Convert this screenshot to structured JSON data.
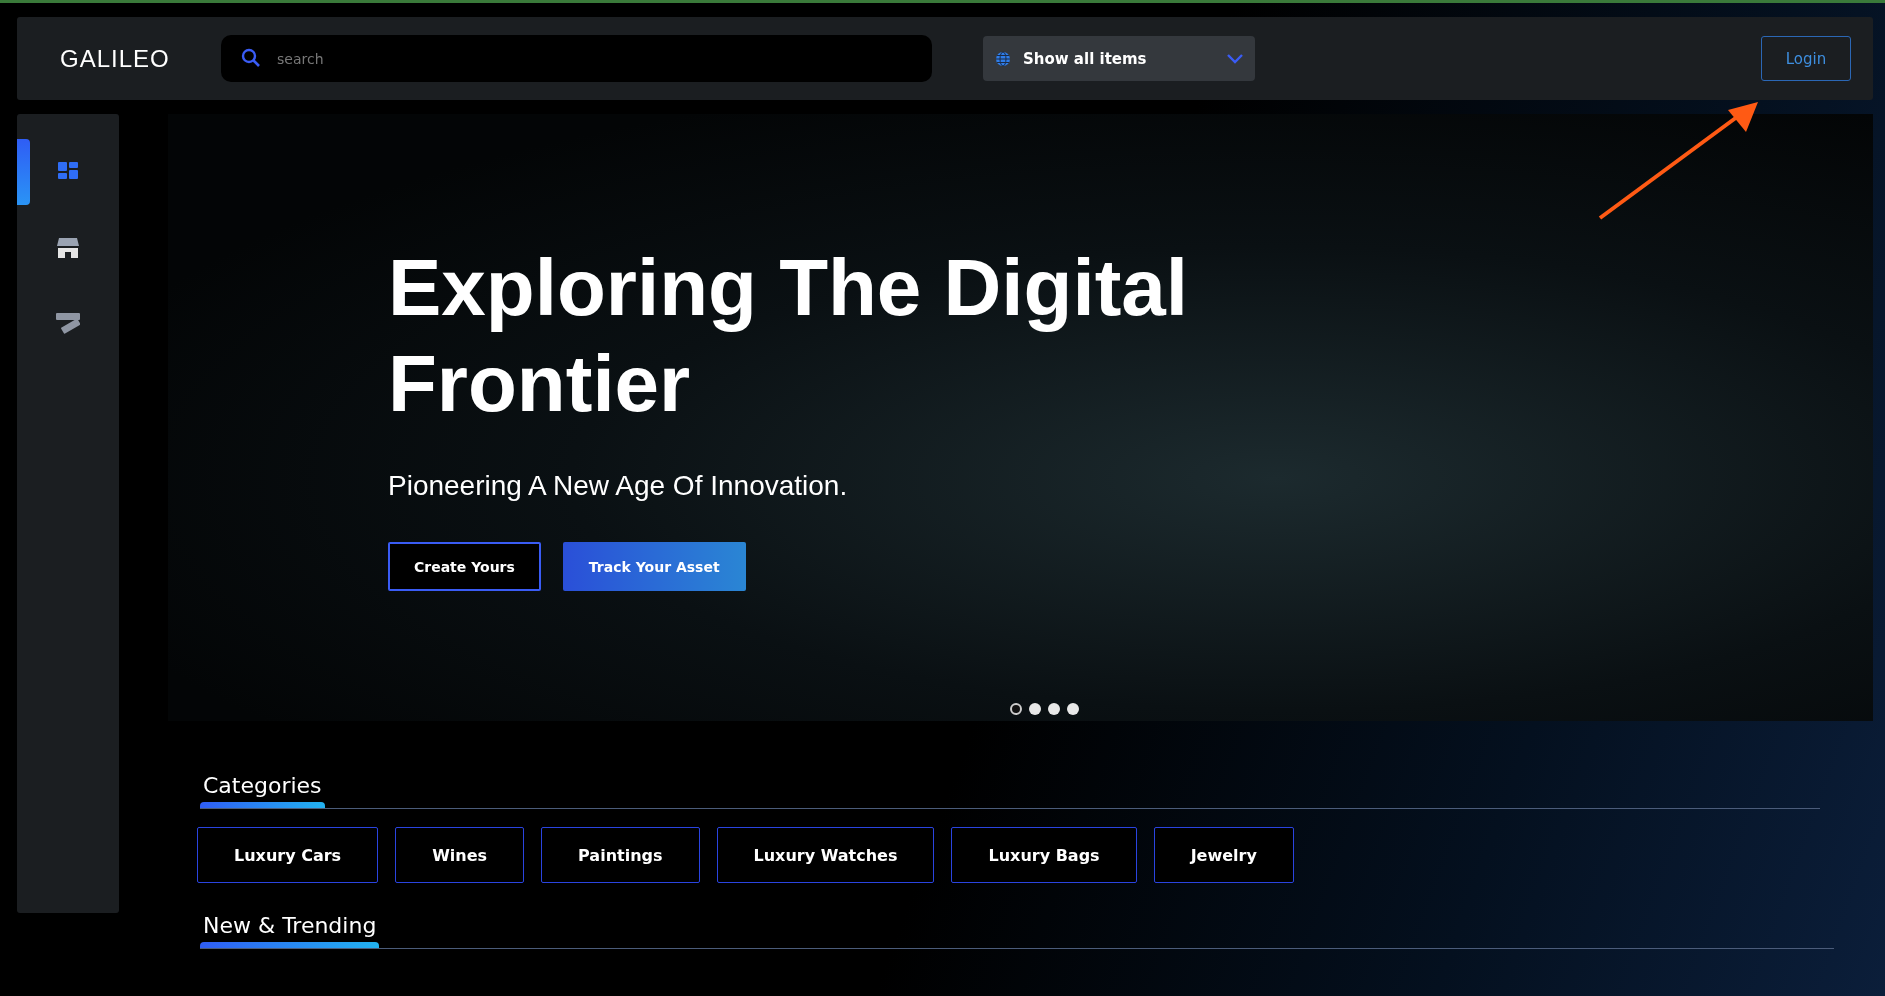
{
  "header": {
    "logo": "GALILEO",
    "search": {
      "placeholder": "search"
    },
    "filter": {
      "value": "Show all items"
    },
    "login": "Login"
  },
  "sidebar": {
    "items": [
      {
        "kind": "grid",
        "selected": true
      },
      {
        "kind": "store",
        "selected": false
      },
      {
        "kind": "coming-soon",
        "selected": false
      }
    ]
  },
  "hero": {
    "title": "Exploring The Digital Frontier",
    "subtitle": "Pioneering A New Age Of Innovation.",
    "buttons": [
      {
        "label": "Create Yours",
        "kind": "outline"
      },
      {
        "label": "Track Your Asset",
        "kind": "filled"
      }
    ],
    "dots": [
      {
        "selected": true
      },
      {
        "selected": false
      },
      {
        "selected": false
      },
      {
        "selected": false
      }
    ]
  },
  "categories": {
    "title": "Categories",
    "items": [
      "Luxury Cars",
      "Wines",
      "Paintings",
      "Luxury Watches",
      "Luxury Bags",
      "Jewelry"
    ]
  },
  "trending": {
    "title": "New & Trending"
  }
}
